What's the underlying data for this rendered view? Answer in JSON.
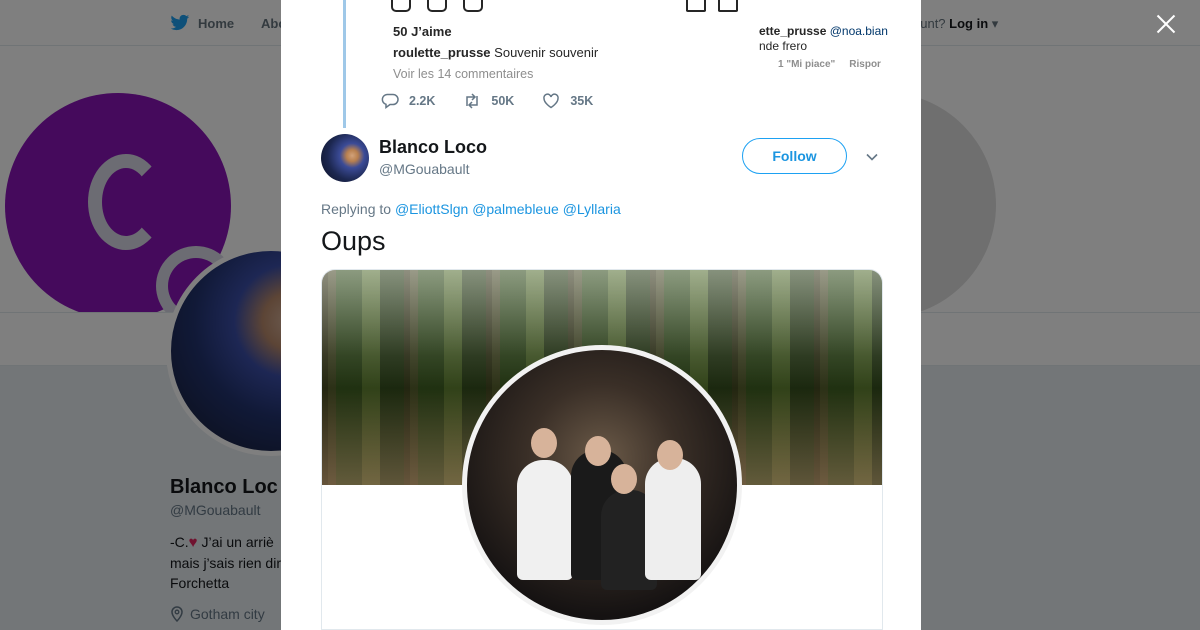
{
  "nav": {
    "home_label": "Home",
    "about_label": "Abo",
    "login_prompt": "ccount?",
    "login_label": "Log in"
  },
  "profile": {
    "name": "Blanco Loc",
    "handle": "@MGouabault",
    "bio_line1": "-C.",
    "bio_line1_rest": "J’ai un arriè",
    "bio_line2": "mais j’sais rien dir",
    "bio_line3": "Forchetta",
    "location": "Gotham city"
  },
  "quoted_instagram": {
    "likes": "50 J’aime",
    "caption_user": "roulette_prusse",
    "caption_text": "Souvenir souvenir",
    "comments_link": "Voir les 14 commentaires",
    "right_user": "ette_prusse",
    "right_mention": "@noa.bian",
    "right_text": "nde frero",
    "right_likes": "1 \"Mi piace\"",
    "right_reply": "Rispor"
  },
  "previous_tweet_stats": {
    "replies": "2.2K",
    "retweets": "50K",
    "likes": "35K"
  },
  "tweet": {
    "author_name": "Blanco Loco",
    "author_handle": "@MGouabault",
    "follow_label": "Follow",
    "replying_prefix": "Replying to",
    "replying_to": [
      "@EliottSlgn",
      "@palmebleue",
      "@Lyllaria"
    ],
    "text": "Oups"
  },
  "colors": {
    "twitter_blue": "#1da1f2",
    "link_blue": "#1b95e0",
    "banner_purple": "#8b14b8",
    "heart_red": "#e0245e"
  },
  "icons": {
    "bird": "twitter-bird-icon",
    "close": "close-icon",
    "reply": "reply-icon",
    "retweet": "retweet-icon",
    "like": "heart-icon",
    "chevron": "chevron-down-icon",
    "location": "location-pin-icon"
  }
}
